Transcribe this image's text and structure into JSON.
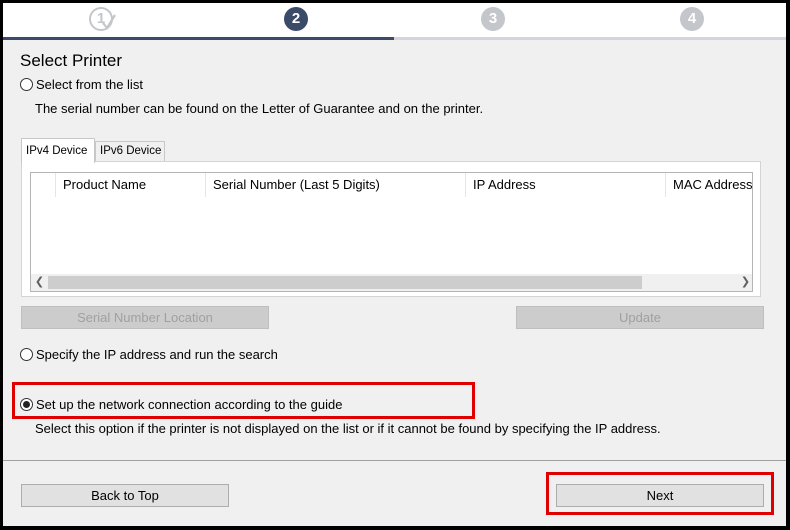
{
  "steps": [
    {
      "label": "1",
      "state": "done"
    },
    {
      "label": "2",
      "state": "current"
    },
    {
      "label": "3",
      "state": "pending"
    },
    {
      "label": "4",
      "state": "pending"
    }
  ],
  "title": "Select Printer",
  "option_list": {
    "label": "Select from the list",
    "selected": false,
    "description": "The serial number can be found on the Letter of Guarantee and on the printer."
  },
  "tabs": [
    {
      "label": "IPv4 Device",
      "active": true
    },
    {
      "label": "IPv6 Device",
      "active": false
    }
  ],
  "table": {
    "columns": [
      "",
      "Product Name",
      "Serial Number (Last 5 Digits)",
      "IP Address",
      "MAC Address"
    ],
    "rows": []
  },
  "buttons": {
    "serial_location": "Serial Number Location",
    "update": "Update",
    "back_to_top": "Back to Top",
    "next": "Next"
  },
  "option_ip": {
    "label": "Specify the IP address and run the search",
    "selected": false
  },
  "option_guide": {
    "label": "Set up the network connection according to the guide",
    "selected": true,
    "description": "Select this option if the printer is not displayed on the list or if it cannot be found by specifying the IP address."
  },
  "colors": {
    "highlight": "#e00000",
    "step_active": "#3b4a68",
    "step_inactive": "#c3c6ca"
  }
}
